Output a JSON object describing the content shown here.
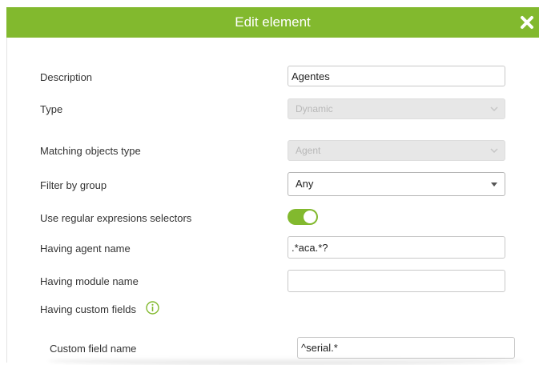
{
  "dialog": {
    "title": "Edit element",
    "close_icon": "close-icon"
  },
  "form": {
    "description": {
      "label": "Description",
      "value": "Agentes"
    },
    "type": {
      "label": "Type",
      "value": "Dynamic"
    },
    "matching_objects_type": {
      "label": "Matching objects type",
      "value": "Agent"
    },
    "filter_by_group": {
      "label": "Filter by group",
      "value": "Any"
    },
    "use_regex": {
      "label": "Use regular expresions selectors",
      "enabled": true
    },
    "agent_name": {
      "label": "Having agent name",
      "value": ".*aca.*?"
    },
    "module_name": {
      "label": "Having module name",
      "value": ""
    },
    "custom_fields": {
      "label": "Having custom fields",
      "info_icon": "info-icon"
    },
    "custom_field_name": {
      "label": "Custom field name",
      "value": "^serial.*"
    }
  },
  "colors": {
    "accent": "#82b92e",
    "disabled_bg": "#e7e7e7"
  }
}
